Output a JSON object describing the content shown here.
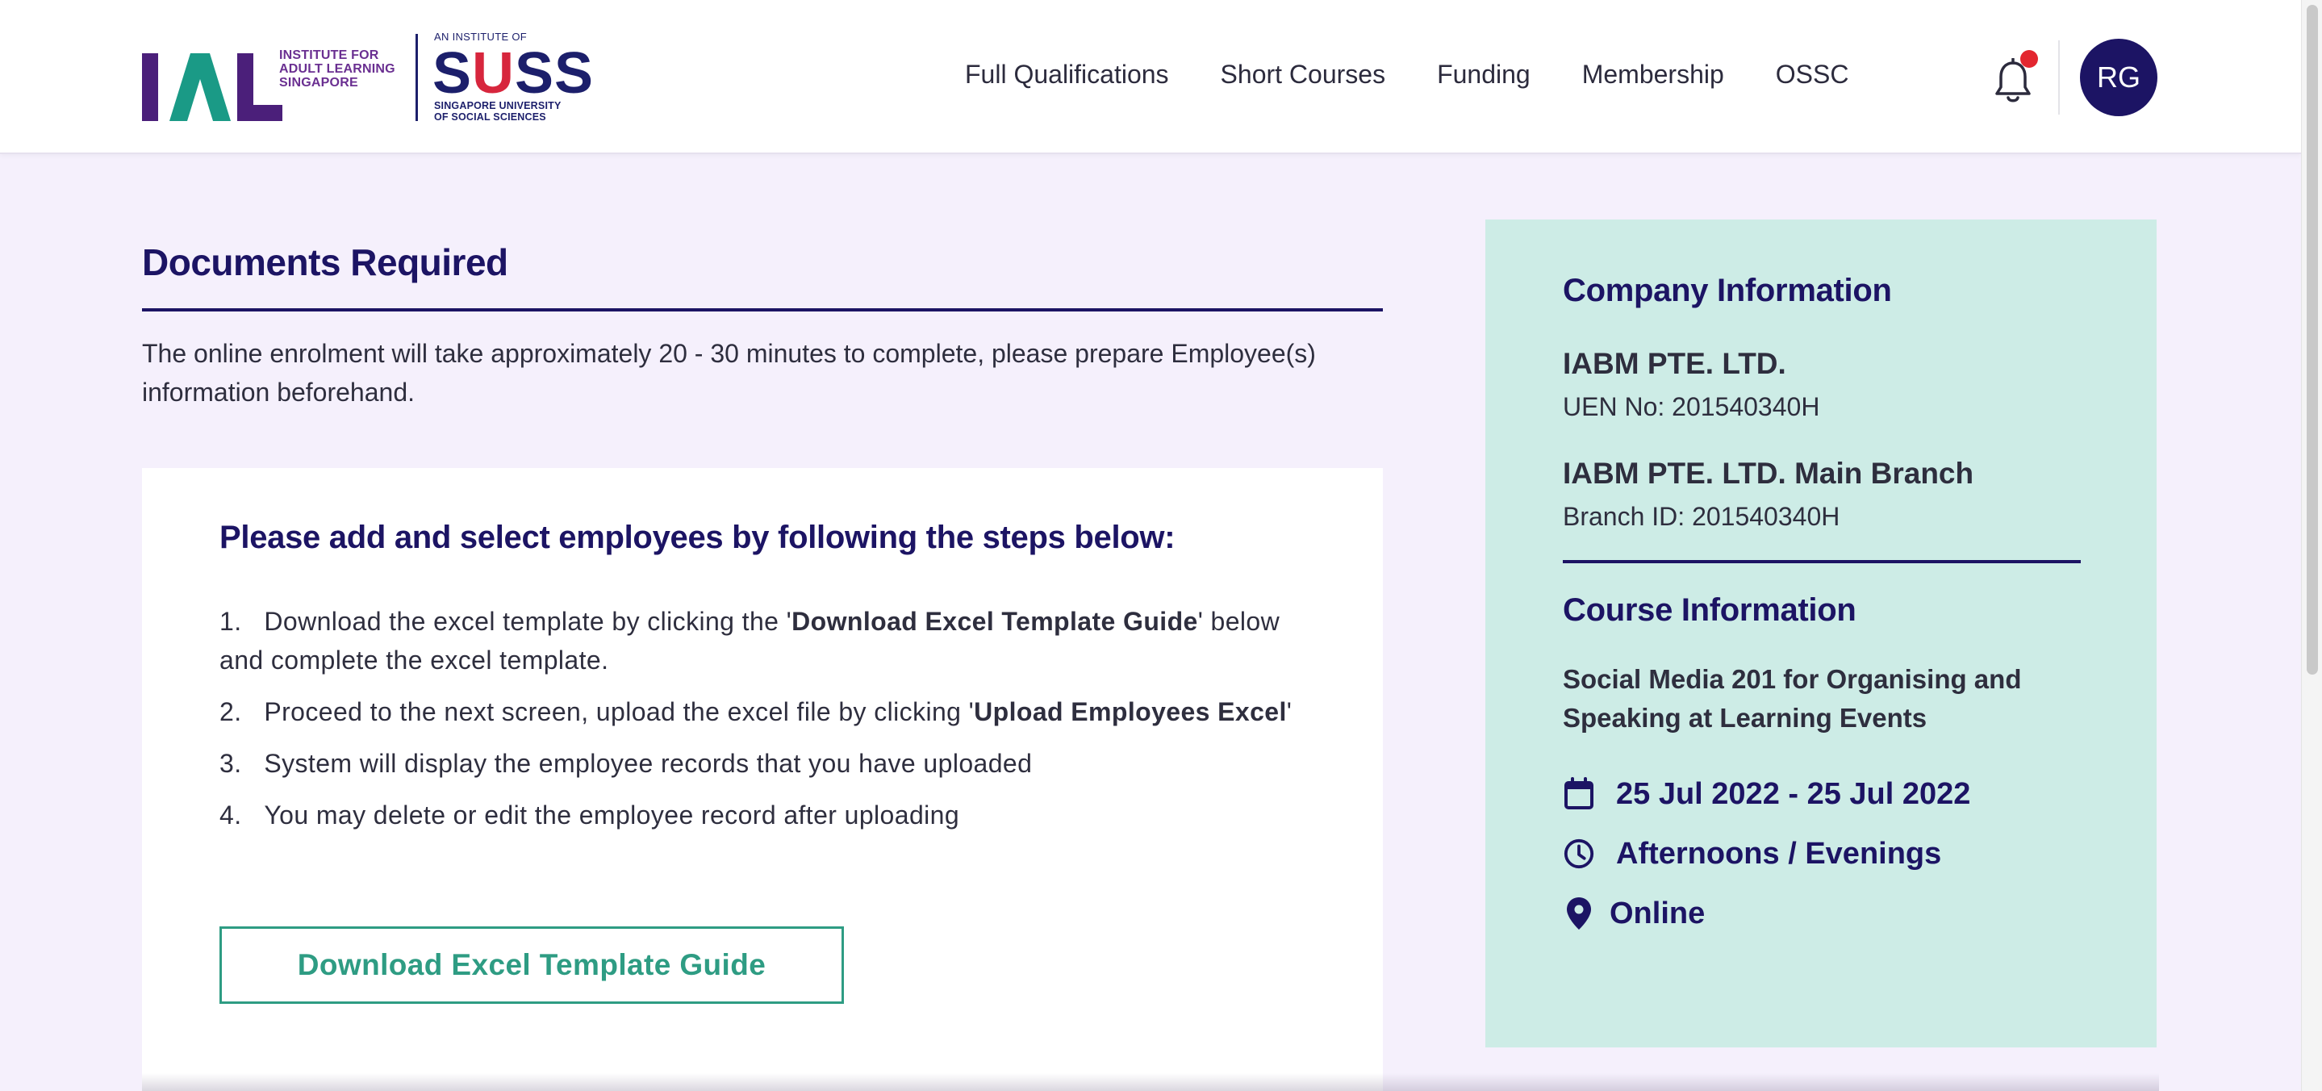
{
  "brand": {
    "ial_wordmark": "IAL",
    "ial_text": [
      "INSTITUTE FOR",
      "ADULT LEARNING",
      "SINGAPORE"
    ],
    "suss_small": "AN INSTITUTE OF",
    "suss_wordmark": "SUSS",
    "suss_sub": [
      "SINGAPORE UNIVERSITY",
      "OF SOCIAL SCIENCES"
    ],
    "colors": {
      "ial_purple": "#4b1f7a",
      "ial_teal": "#1a9a86",
      "suss_navy": "#1c1f6b",
      "suss_red": "#d7263d"
    }
  },
  "nav": {
    "items": [
      "Full Qualifications",
      "Short Courses",
      "Funding",
      "Membership",
      "OSSC"
    ],
    "notification_icon": "bell-icon",
    "has_unread_notification": true,
    "avatar_initials": "RG"
  },
  "documents": {
    "title": "Documents Required",
    "description": "The online enrolment will take approximately 20 - 30 minutes to complete, please prepare Employee(s) information beforehand."
  },
  "steps": {
    "title": "Please add and select employees by following the steps below:",
    "items": [
      {
        "number": "1.",
        "before": "Download the excel template by clicking the '",
        "bold": "Download Excel Template Guide",
        "after": "' below and complete the excel template."
      },
      {
        "number": "2.",
        "before": "Proceed to the next screen, upload the excel file by clicking '",
        "bold": "Upload Employees Excel",
        "after": "'"
      },
      {
        "number": "3.",
        "before": "System will display the employee records that you have uploaded",
        "bold": "",
        "after": ""
      },
      {
        "number": "4.",
        "before": "You may delete or edit the employee record after uploading",
        "bold": "",
        "after": ""
      }
    ],
    "download_button": "Download Excel Template Guide"
  },
  "company": {
    "heading": "Company Information",
    "name": "IABM PTE. LTD.",
    "uen": "UEN No: 201540340H",
    "branch_name": "IABM PTE. LTD. Main Branch",
    "branch_id": "Branch ID: 201540340H"
  },
  "course": {
    "heading": "Course Information",
    "name": "Social Media 201 for Organising and Speaking at Learning Events",
    "date": "25 Jul 2022 - 25 Jul 2022",
    "date_icon": "calendar-icon",
    "time": "Afternoons / Evenings",
    "time_icon": "clock-icon",
    "location": "Online",
    "location_icon": "map-pin-icon"
  },
  "theme": {
    "page_bg": "#f5f0fc",
    "navy": "#1c1464",
    "accent_green": "#2e9c83",
    "panel_bg": "#cdece6",
    "notification_dot": "#e3262f"
  }
}
